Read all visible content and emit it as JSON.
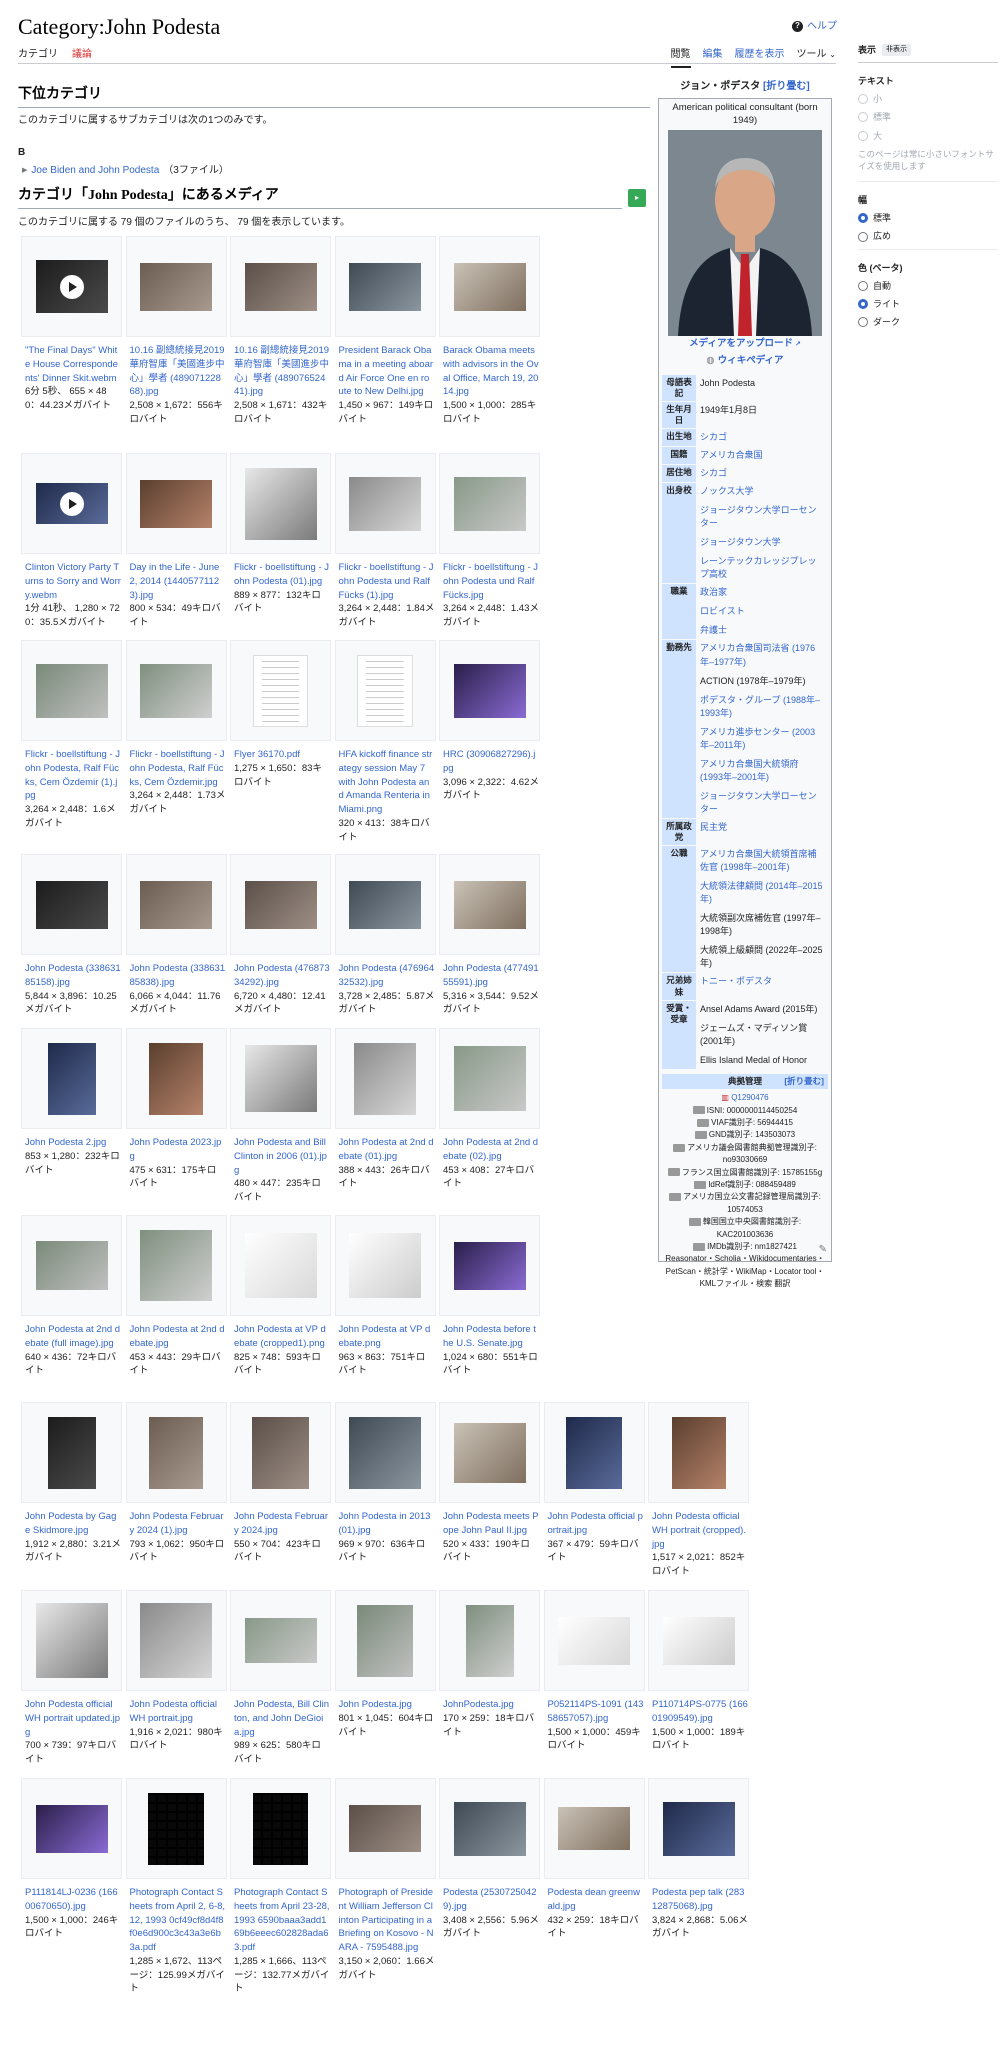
{
  "page": {
    "title": "Category:John Podesta",
    "help": "ヘルプ"
  },
  "tabs": {
    "left": [
      "カテゴリ",
      "議論"
    ],
    "right": [
      "閲覧",
      "編集",
      "履歴を表示",
      "ツール"
    ]
  },
  "display_panel": {
    "title": "表示",
    "hide": "非表示",
    "text_label": "テキスト",
    "text_options": [
      "小",
      "標準",
      "大"
    ],
    "text_note": "このページは常に小さいフォントサイズを使用します",
    "width_label": "幅",
    "width_options": [
      "標準",
      "広め"
    ],
    "color_label": "色 (ベータ)",
    "color_options": [
      "自動",
      "ライト",
      "ダーク"
    ]
  },
  "subcategories": {
    "heading": "下位カテゴリ",
    "description": "このカテゴリに属するサブカテゴリは次の1つのみです。",
    "letter": "B",
    "item": {
      "label": "Joe Biden and John Podesta",
      "count": "（3ファイル）"
    }
  },
  "media": {
    "heading": "カテゴリ「John Podesta」にあるメディア",
    "description": "このカテゴリに属する 79 個のファイルのうち、 79 個を表示しています。",
    "items": [
      {
        "name": "\"The Final Days\" White House Correspondents' Dinner Skit.webm",
        "meta": "6分 5秒、 655 × 480：44.23メガバイト"
      },
      {
        "name": "10.16 副總統接見2019華府智庫「美國進步中心」學者 (48907122868).jpg",
        "meta": "2,508 × 1,672：556キロバイト"
      },
      {
        "name": "10.16 副總統接見2019華府智庫「美國進步中心」學者 (48907652441).jpg",
        "meta": "2,508 × 1,671：432キロバイト"
      },
      {
        "name": "President Barack Obama in a meeting aboard Air Force One en route to New Delhi.jpg",
        "meta": "1,450 × 967：149キロバイト"
      },
      {
        "name": "Barack Obama meets with advisors in the Oval Office, March 19, 2014.jpg",
        "meta": "1,500 × 1,000：285キロバイト"
      },
      {
        "name": "Clinton Victory Party Turns to Sorry and Worry.webm",
        "meta": "1分 41秒、 1,280 × 720：35.5メガバイト"
      },
      {
        "name": "Day in the Life - June 2, 2014 (14405771123).jpg",
        "meta": "800 × 534：49キロバイト"
      },
      {
        "name": "Flickr - boellstiftung - John Podesta (01).jpg",
        "meta": "889 × 877：132キロバイト"
      },
      {
        "name": "Flickr - boellstiftung - John Podesta und Ralf Fücks (1).jpg",
        "meta": "3,264 × 2,448：1.84メガバイト"
      },
      {
        "name": "Flickr - boellstiftung - John Podesta und Ralf Fücks.jpg",
        "meta": "3,264 × 2,448：1.43メガバイト"
      },
      {
        "name": "Flickr - boellstiftung - John Podesta, Ralf Fücks, Cem Özdemir (1).jpg",
        "meta": "3,264 × 2,448：1.6メガバイト"
      },
      {
        "name": "Flickr - boellstiftung - John Podesta, Ralf Fücks, Cem Özdemir.jpg",
        "meta": "3,264 × 2,448：1.73メガバイト"
      },
      {
        "name": "Flyer 36170.pdf",
        "meta": "1,275 × 1,650：83キロバイト"
      },
      {
        "name": "HFA kickoff finance strategy session May 7 with John Podesta and Amanda Renteria in Miami.png",
        "meta": "320 × 413：38キロバイト"
      },
      {
        "name": "HRC (30906827296).jpg",
        "meta": "3,096 × 2,322：4.62メガバイト"
      },
      {
        "name": "John Podesta (33863185158).jpg",
        "meta": "5,844 × 3,896：10.25メガバイト"
      },
      {
        "name": "John Podesta (33863185838).jpg",
        "meta": "6,066 × 4,044：11.76メガバイト"
      },
      {
        "name": "John Podesta (47687334292).jpg",
        "meta": "6,720 × 4,480：12.41メガバイト"
      },
      {
        "name": "John Podesta (47696432532).jpg",
        "meta": "3,728 × 2,485：5.87メガバイト"
      },
      {
        "name": "John Podesta (47749155591).jpg",
        "meta": "5,316 × 3,544：9.52メガバイト"
      },
      {
        "name": "John Podesta 2.jpg",
        "meta": "853 × 1,280：232キロバイト"
      },
      {
        "name": "John Podesta 2023.jpg",
        "meta": "475 × 631：175キロバイト"
      },
      {
        "name": "John Podesta and Bill Clinton in 2006 (01).jpg",
        "meta": "480 × 447：235キロバイト"
      },
      {
        "name": "John Podesta at 2nd debate (01).jpg",
        "meta": "388 × 443：26キロバイト"
      },
      {
        "name": "John Podesta at 2nd debate (02).jpg",
        "meta": "453 × 408：27キロバイト"
      },
      {
        "name": "John Podesta at 2nd debate (full image).jpg",
        "meta": "640 × 436：72キロバイト"
      },
      {
        "name": "John Podesta at 2nd debate.jpg",
        "meta": "453 × 443：29キロバイト"
      },
      {
        "name": "John Podesta at VP debate (cropped1).png",
        "meta": "825 × 748：593キロバイト"
      },
      {
        "name": "John Podesta at VP debate.png",
        "meta": "963 × 863：751キロバイト"
      },
      {
        "name": "John Podesta before the U.S. Senate.jpg",
        "meta": "1,024 × 680：551キロバイト"
      },
      {
        "name": "John Podesta by Gage Skidmore.jpg",
        "meta": "1,912 × 2,880：3.21メガバイト"
      },
      {
        "name": "John Podesta February 2024 (1).jpg",
        "meta": "793 × 1,062：950キロバイト"
      },
      {
        "name": "John Podesta February 2024.jpg",
        "meta": "550 × 704：423キロバイト"
      },
      {
        "name": "John Podesta in 2013 (01).jpg",
        "meta": "969 × 970：636キロバイト"
      },
      {
        "name": "John Podesta meets Pope John Paul II.jpg",
        "meta": "520 × 433：190キロバイト"
      },
      {
        "name": "John Podesta official portrait.jpg",
        "meta": "367 × 479：59キロバイト"
      },
      {
        "name": "John Podesta official WH portrait (cropped).jpg",
        "meta": "1,517 × 2,021：852キロバイト"
      },
      {
        "name": "John Podesta official WH portrait updated.jpg",
        "meta": "700 × 739：97キロバイト"
      },
      {
        "name": "John Podesta official WH portrait.jpg",
        "meta": "1,916 × 2,021：980キロバイト"
      },
      {
        "name": "John Podesta, Bill Clinton, and John DeGioia.jpg",
        "meta": "989 × 625：580キロバイト"
      },
      {
        "name": "John Podesta.jpg",
        "meta": "801 × 1,045：604キロバイト"
      },
      {
        "name": "JohnPodesta.jpg",
        "meta": "170 × 259：18キロバイト"
      },
      {
        "name": "P052114PS-1091 (14358657057).jpg",
        "meta": "1,500 × 1,000：459キロバイト"
      },
      {
        "name": "P110714PS-0775 (16601909549).jpg",
        "meta": "1,500 × 1,000：189キロバイト"
      },
      {
        "name": "P111814LJ-0236 (16600670650).jpg",
        "meta": "1,500 × 1,000：246キロバイト"
      },
      {
        "name": "Photograph Contact Sheets from April 2, 6-8, 12, 1993 0cf49cf8d4f8f0e6d900c3c43a3e6b3a.pdf",
        "meta": "1,285 × 1,672、113ページ：125.99メガバイト"
      },
      {
        "name": "Photograph Contact Sheets from April 23-28, 1993 6590baaa3add169b6eeec602828ada63.pdf",
        "meta": "1,285 × 1,666、113ページ：132.77メガバイト"
      },
      {
        "name": "Photograph of President William Jefferson Clinton Participating in a Briefing on Kosovo - NARA - 7595488.jpg",
        "meta": "3,150 × 2,060：1.66メガバイト"
      },
      {
        "name": "Podesta (25307250429).jpg",
        "meta": "3,408 × 2,556：5.96メガバイト"
      },
      {
        "name": "Podesta dean greenwald.jpg",
        "meta": "432 × 259：18キロバイト"
      },
      {
        "name": "Podesta pep talk (28312875068).jpg",
        "meta": "3,824 × 2,868：5.06メガバイト"
      }
    ]
  },
  "infobox": {
    "title": "ジョン・ポデスタ",
    "fold": "[折り畳む]",
    "caption": "American political consultant (born 1949)",
    "upload": "メディアをアップロード",
    "wikidata": "ウィキペディア",
    "rows": [
      {
        "label": "母語表記",
        "values": [
          "John Podesta"
        ],
        "link": [
          false
        ]
      },
      {
        "label": "生年月日",
        "values": [
          "1949年1月8日"
        ],
        "link": [
          false
        ]
      },
      {
        "label": "出生地",
        "values": [
          "シカゴ"
        ],
        "link": [
          true
        ]
      },
      {
        "label": "国籍",
        "values": [
          "アメリカ合衆国"
        ],
        "link": [
          true
        ]
      },
      {
        "label": "居住地",
        "values": [
          "シカゴ"
        ],
        "link": [
          true
        ]
      },
      {
        "label": "出身校",
        "values": [
          "ノックス大学",
          "ジョージタウン大学ローセンター",
          "ジョージタウン大学",
          "レーンテックカレッジプレップ高校"
        ],
        "link": [
          true,
          true,
          true,
          true
        ]
      },
      {
        "label": "職業",
        "values": [
          "政治家",
          "ロビイスト",
          "弁護士"
        ],
        "link": [
          true,
          true,
          true
        ]
      },
      {
        "label": "勤務先",
        "values": [
          "アメリカ合衆国司法省 (1976年–1977年)",
          "ACTION (1978年–1979年)",
          "ポデスタ・グループ (1988年–1993年)",
          "アメリカ進歩センター (2003年–2011年)",
          "アメリカ合衆国大統領府 (1993年–2001年)",
          "ジョージタウン大学ローセンター"
        ],
        "link": [
          true,
          false,
          true,
          true,
          true,
          true
        ]
      },
      {
        "label": "所属政党",
        "values": [
          "民主党"
        ],
        "link": [
          true
        ]
      },
      {
        "label": "公職",
        "values": [
          "アメリカ合衆国大統領首席補佐官 (1998年–2001年)",
          "大統領法律顧問 (2014年–2015年)",
          "大統領副次席補佐官 (1997年–1998年)",
          "大統領上級顧問 (2022年–2025年)"
        ],
        "link": [
          true,
          true,
          false,
          false
        ]
      },
      {
        "label": "兄弟姉妹",
        "values": [
          "トニー・ポデスタ"
        ],
        "link": [
          true
        ]
      },
      {
        "label": "受賞・受章",
        "values": [
          "Ansel Adams Award (2015年)",
          "ジェームズ・マディソン賞 (2001年)",
          "Ellis Island Medal of Honor"
        ],
        "link": [
          false,
          false,
          false
        ]
      }
    ],
    "authority": {
      "title": "典拠管理",
      "fold": "[折り畳む]",
      "q": "Q1290476",
      "lines": [
        "ISNI: 0000000114450254",
        "VIAF識別子: 56944415",
        "GND識別子: 143503073",
        "アメリカ議会図書館典拠管理識別子: no93030669",
        "フランス国立図書館識別子: 15785155g",
        "IdRef識別子: 088459489",
        "アメリカ国立公文書記録管理局識別子: 10574053",
        "韓国国立中央図書館識別子: KAC201003636",
        "IMDb識別子: nm1827421",
        "Reasonator・Scholia・Wikidocumentaries・PetScan・統計学・WikiMap・Locator tool・KMLファイル・検索 翻訳"
      ]
    }
  }
}
